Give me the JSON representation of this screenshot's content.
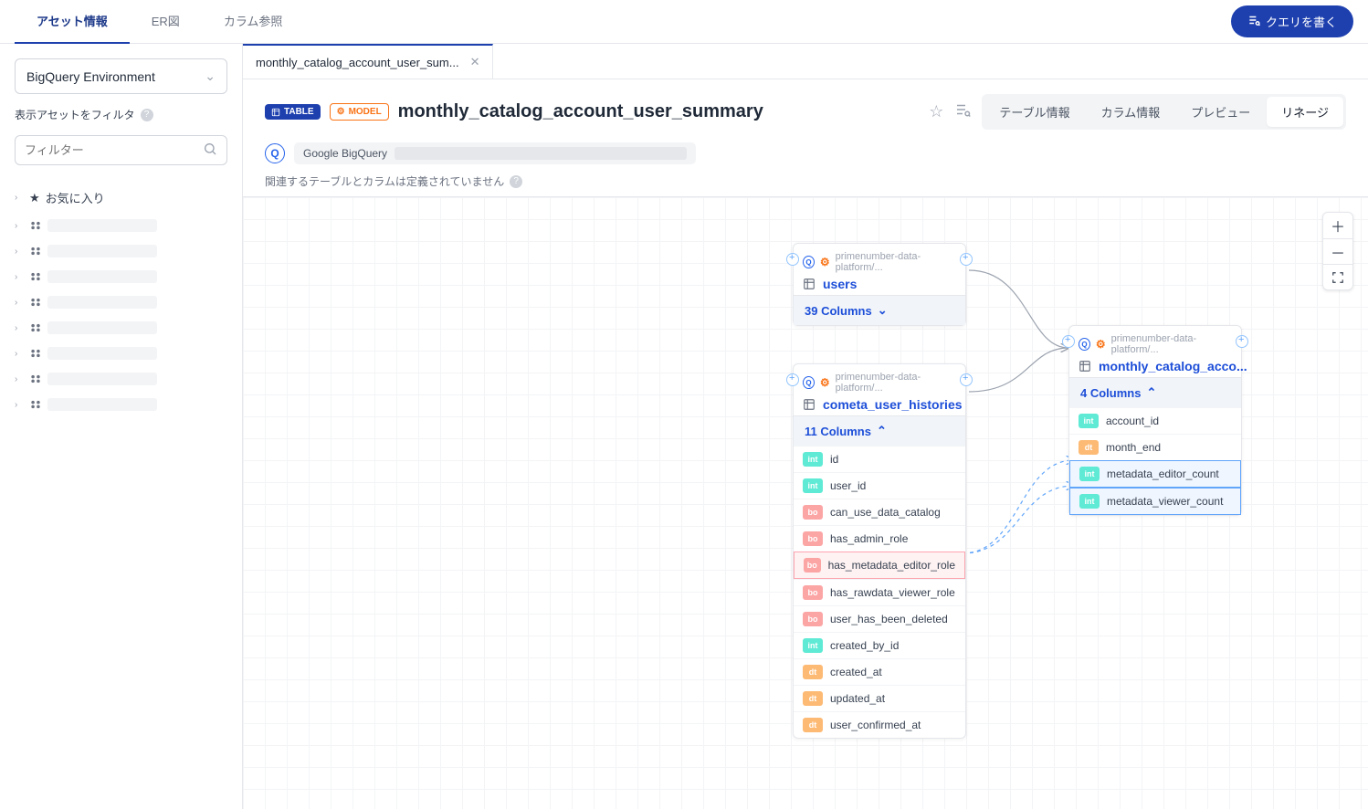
{
  "topTabs": {
    "assetInfo": "アセット情報",
    "erDiagram": "ER図",
    "columnRef": "カラム参照"
  },
  "queryButton": "クエリを書く",
  "sidebar": {
    "envSelect": "BigQuery Environment",
    "filterLabel": "表示アセットをフィルタ",
    "filterPlaceholder": "フィルター",
    "favorites": "お気に入り"
  },
  "fileTab": {
    "label": "monthly_catalog_account_user_sum..."
  },
  "header": {
    "tableBadge": "TABLE",
    "modelBadge": "MODEL",
    "title": "monthly_catalog_account_user_summary",
    "source": "Google BigQuery",
    "note": "関連するテーブルとカラムは定義されていません",
    "subTabs": {
      "tableInfo": "テーブル情報",
      "columnInfo": "カラム情報",
      "preview": "プレビュー",
      "lineage": "リネージ"
    }
  },
  "nodes": {
    "users": {
      "path": "primenumber-data-platform/...",
      "title": "users",
      "colsHeader": "39 Columns"
    },
    "histories": {
      "path": "primenumber-data-platform/...",
      "title": "cometa_user_histories",
      "colsHeader": "11 Columns",
      "cols": {
        "c0": "id",
        "c1": "user_id",
        "c2": "can_use_data_catalog",
        "c3": "has_admin_role",
        "c4": "has_metadata_editor_role",
        "c5": "has_rawdata_viewer_role",
        "c6": "user_has_been_deleted",
        "c7": "created_by_id",
        "c8": "created_at",
        "c9": "updated_at",
        "c10": "user_confirmed_at"
      }
    },
    "summary": {
      "path": "primenumber-data-platform/...",
      "title": "monthly_catalog_acco...",
      "colsHeader": "4 Columns",
      "cols": {
        "c0": "account_id",
        "c1": "month_end",
        "c2": "metadata_editor_count",
        "c3": "metadata_viewer_count"
      }
    }
  }
}
